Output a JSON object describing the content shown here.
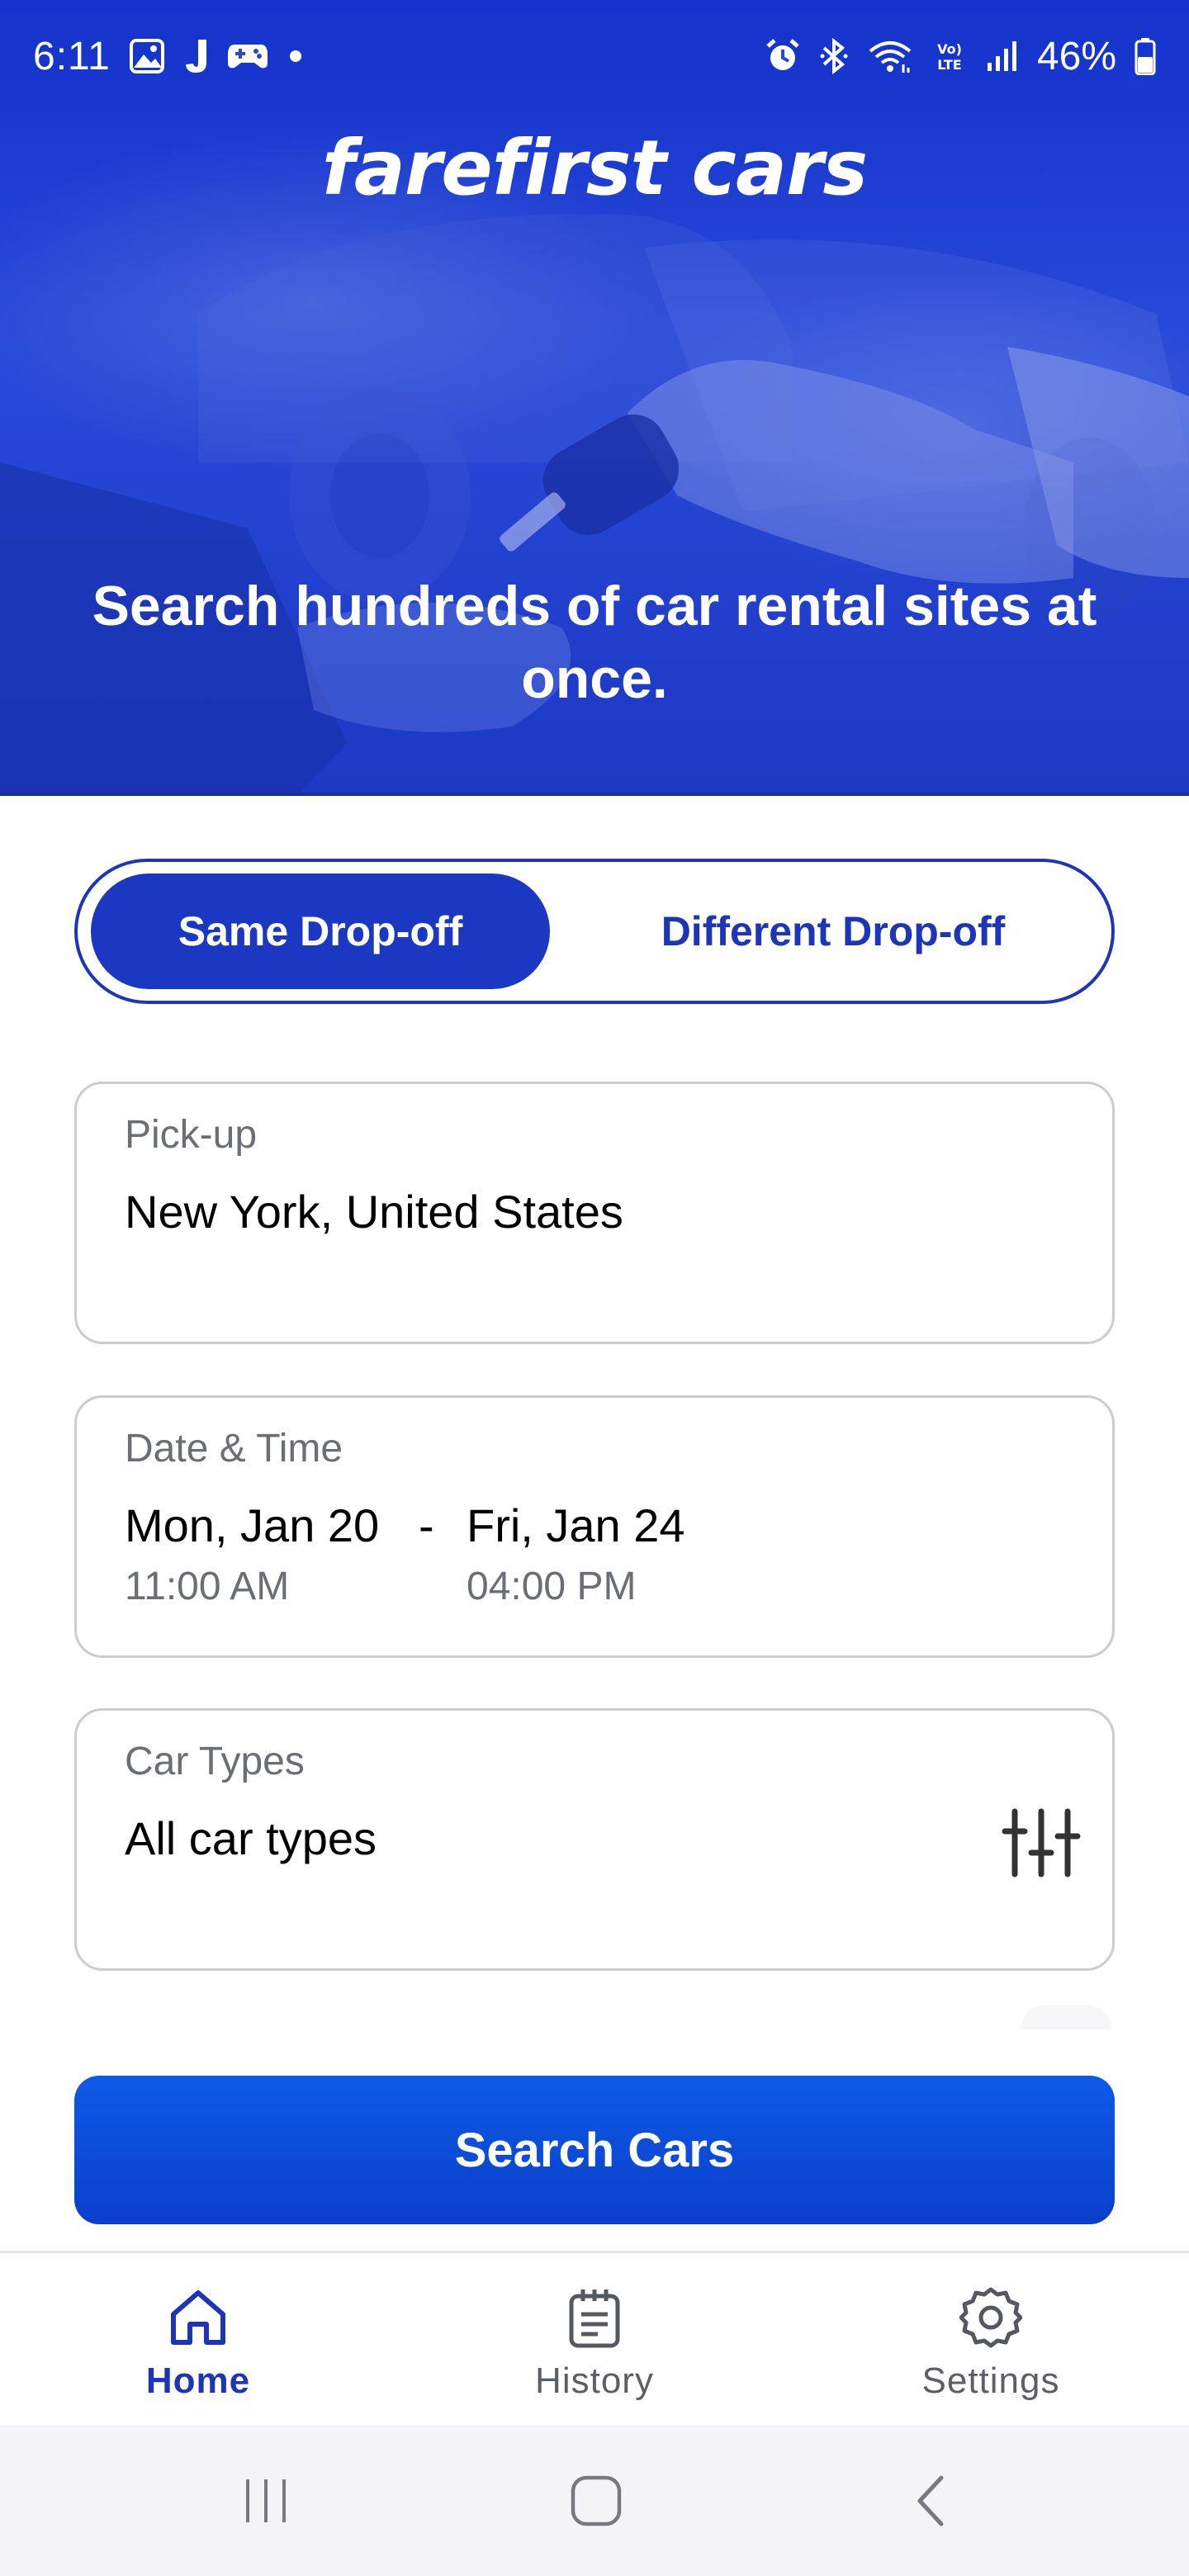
{
  "status_bar": {
    "time": "6:11",
    "battery_percent": "46%",
    "left_icons": [
      "gallery-icon",
      "j-app-icon",
      "game-controller-icon",
      "dot-icon"
    ],
    "right_icons": [
      "alarm-icon",
      "bluetooth-icon",
      "wifi-icon",
      "volte-icon",
      "signal-icon",
      "battery-icon"
    ]
  },
  "hero": {
    "logo_text": "farefirst cars",
    "title": "Search hundreds of car rental sites at once."
  },
  "trip_toggle": {
    "options": [
      "Same Drop-off",
      "Different Drop-off"
    ],
    "selected": "Same Drop-off"
  },
  "pickup": {
    "label": "Pick-up",
    "value": "New York, United States"
  },
  "date_time": {
    "label": "Date & Time",
    "start_date": "Mon, Jan 20",
    "start_time": "11:00 AM",
    "separator": "-",
    "end_date": "Fri, Jan 24",
    "end_time": "04:00 PM"
  },
  "car_types": {
    "label": "Car Types",
    "value": "All car types",
    "icon": "filter-sliders-icon"
  },
  "search_button": {
    "label": "Search Cars"
  },
  "bottom_nav": {
    "items": [
      {
        "label": "Home",
        "icon": "home-icon",
        "active": true
      },
      {
        "label": "History",
        "icon": "history-icon",
        "active": false
      },
      {
        "label": "Settings",
        "icon": "settings-icon",
        "active": false
      }
    ]
  },
  "system_nav": {
    "buttons": [
      "recent-apps-icon",
      "home-circle-icon",
      "back-icon"
    ]
  },
  "colors": {
    "brand_blue": "#1b38c2",
    "button_blue": "#0a3fcb",
    "border_gray": "#c9ccd1",
    "label_gray": "#6b6e73"
  }
}
